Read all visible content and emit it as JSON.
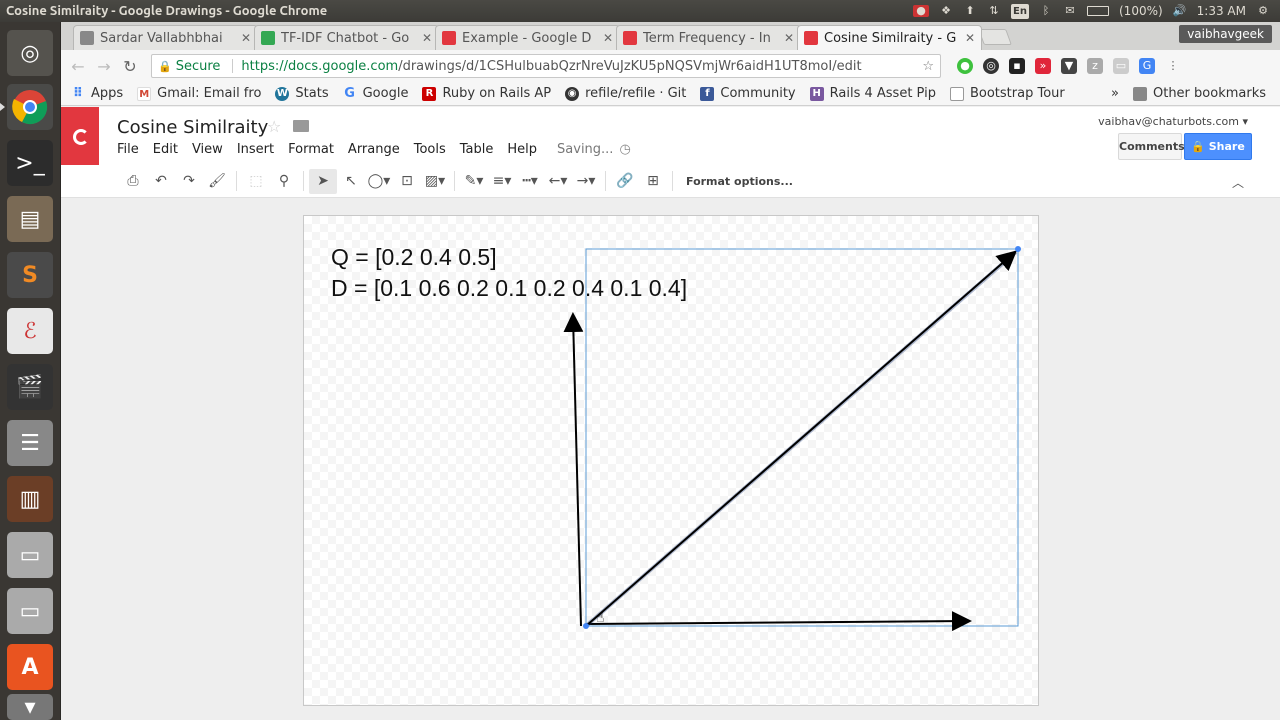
{
  "os": {
    "window_title": "Cosine Similraity - Google Drawings - Google Chrome",
    "battery": "(100%)",
    "clock": "1:33 AM",
    "lang": "En"
  },
  "browser": {
    "profile": "vaibhavgeek",
    "tabs": [
      {
        "label": "Sardar Vallabhbhai",
        "favicon_color": "#888888"
      },
      {
        "label": "TF-IDF Chatbot - Go",
        "favicon_color": "#34a853"
      },
      {
        "label": "Example - Google D",
        "favicon_color": "#e2373f"
      },
      {
        "label": "Term Frequency - In",
        "favicon_color": "#e2373f"
      },
      {
        "label": "Cosine Similraity - G",
        "favicon_color": "#e2373f"
      }
    ],
    "secure_label": "Secure",
    "url_host": "https://docs.google.com",
    "url_path": "/drawings/d/1CSHulbuabQzrNreVuJzKU5pNQSVmjWr6aidH1UT8moI/edit",
    "bookmarks": [
      {
        "label": "Apps",
        "icon": "apps-grid-icon",
        "color": "#4285f4"
      },
      {
        "label": "Gmail: Email fro",
        "icon": "gmail-icon",
        "color": "#d14836"
      },
      {
        "label": "Stats",
        "icon": "wordpress-icon",
        "color": "#21759b"
      },
      {
        "label": "Google",
        "icon": "google-icon",
        "color": "#4285f4"
      },
      {
        "label": "Ruby on Rails AP",
        "icon": "rails-icon",
        "color": "#cc0000"
      },
      {
        "label": "refile/refile · Git",
        "icon": "github-icon",
        "color": "#333333"
      },
      {
        "label": "Community",
        "icon": "facebook-icon",
        "color": "#3b5998"
      },
      {
        "label": "Rails 4 Asset Pip",
        "icon": "heroku-icon",
        "color": "#79589f"
      },
      {
        "label": "Bootstrap Tour",
        "icon": "page-icon",
        "color": "#999999"
      }
    ],
    "bookmarks_more": "»",
    "other_bookmarks": "Other bookmarks"
  },
  "app": {
    "doc_title": "Cosine Similraity",
    "menu": [
      "File",
      "Edit",
      "View",
      "Insert",
      "Format",
      "Arrange",
      "Tools",
      "Table",
      "Help"
    ],
    "saving": "Saving...",
    "user_email": "vaibhav@chaturbots.com",
    "comments_label": "Comments",
    "share_label": "Share",
    "format_options": "Format options...",
    "accent": "#4d90fe"
  },
  "canvas": {
    "q_text": "Q = [0.2 0.4 0.5]",
    "d_text": "D = [0.1 0.6 0.2 0.1 0.2 0.4 0.1 0.4]"
  }
}
